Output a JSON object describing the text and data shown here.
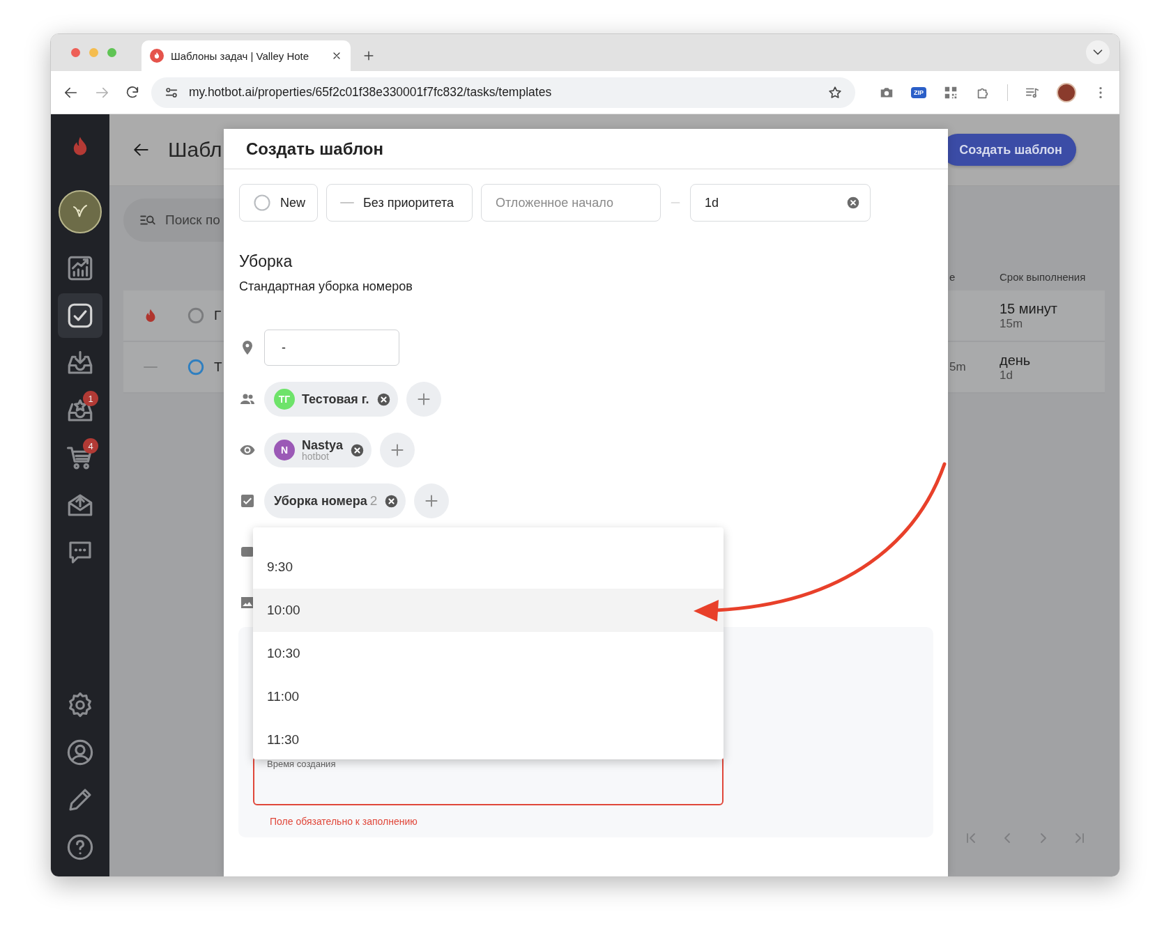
{
  "browser": {
    "tab_title": "Шаблоны задач | Valley Hote",
    "url": "my.hotbot.ai/properties/65f2c01f38e330001f7fc832/tasks/templates",
    "extensions": [
      {
        "kind": "camera"
      },
      {
        "kind": "badge",
        "label": "ZIP"
      },
      {
        "kind": "qr"
      },
      {
        "kind": "puzzle"
      }
    ]
  },
  "sidebar": {
    "items": [
      {
        "selected": false
      },
      {
        "selected": true
      },
      {
        "selected": false
      },
      {
        "selected": false,
        "badge": "1"
      },
      {
        "selected": false,
        "badge": "4"
      },
      {
        "selected": false
      },
      {
        "selected": false
      }
    ],
    "bottom_items": [
      {
        "selected": false
      },
      {
        "selected": false
      },
      {
        "selected": false
      },
      {
        "selected": false
      }
    ]
  },
  "page": {
    "title": "Шабл",
    "create_button": "Создать шаблон",
    "search": {
      "placeholder": "Поиск по"
    },
    "columns": [
      "е",
      "Срок выполнения"
    ],
    "rows": [
      {
        "kind": "urgent",
        "color": "#7b7c7e",
        "title": "Г",
        "deadline": "15 минут",
        "deadline_short": "15m"
      },
      {
        "kind": "plain",
        "color": "#2f7fc0",
        "title": "Т",
        "column_4": "5m",
        "deadline": "день",
        "deadline_short": "1d"
      }
    ]
  },
  "modal": {
    "title": "Создать шаблон",
    "status": "New",
    "priority": "Без приоритета",
    "delayed_start": {
      "placeholder": "Отложенное начало"
    },
    "duration": {
      "value": "1d"
    },
    "name": "Уборка",
    "description": "Стандартная уборка номеров",
    "location": {
      "value": "-"
    },
    "assignees": [
      {
        "initials": "ТГ",
        "name": "Тестовая г.",
        "color": "#6ee36a"
      }
    ],
    "watchers": [
      {
        "initials": "N",
        "name": "Nastya",
        "subtitle": "hotbot",
        "color": "#9b59b6"
      }
    ],
    "checklists": [
      {
        "name": "Уборка номера",
        "count": "2"
      }
    ],
    "time_dropdown": {
      "options": [
        {
          "label": "9:30",
          "selected": false
        },
        {
          "label": "10:00",
          "selected": true
        },
        {
          "label": "10:30",
          "selected": false
        },
        {
          "label": "11:00",
          "selected": false
        },
        {
          "label": "11:30",
          "selected": false
        }
      ]
    },
    "creation_time": {
      "label": "Время создания",
      "invalid": true,
      "error": "Поле обязательно к заполнению"
    }
  },
  "annotations": [
    {
      "kind": "curved_arrow",
      "color": "#e8402a"
    }
  ]
}
